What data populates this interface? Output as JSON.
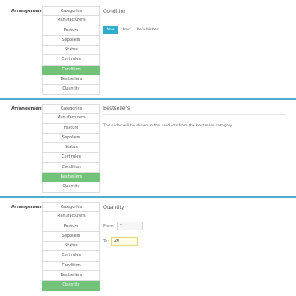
{
  "panels": [
    {
      "arrangement_label": "Arrangement",
      "menu": [
        "Categories",
        "Manufacturers",
        "Feature",
        "Suppliers",
        "Status",
        "Cart rules",
        "Condition",
        "Bestsellers",
        "Quantity"
      ],
      "active_item": "Condition",
      "title": "Condition",
      "condition_buttons": [
        "New",
        "Used",
        "Refurbished"
      ],
      "active_button": "New"
    },
    {
      "arrangement_label": "Arrangement",
      "menu": [
        "Categories",
        "Manufacturers",
        "Feature",
        "Suppliers",
        "Status",
        "Cart rules",
        "Condition",
        "Bestsellers",
        "Quantity"
      ],
      "active_item": "Bestsellers",
      "title": "Bestsellers",
      "description": "The slider will be shown in the products from the bestseller category"
    },
    {
      "arrangement_label": "Arrangement",
      "menu": [
        "Categories",
        "Manufacturers",
        "Feature",
        "Suppliers",
        "Status",
        "Cart rules",
        "Condition",
        "Bestsellers",
        "Quantity"
      ],
      "active_item": "Quantity",
      "title": "Quantity",
      "from_label": "From:",
      "from_value": "5",
      "to_label": "To:",
      "to_value": "20"
    }
  ],
  "colors": {
    "active_menu": "#72c279",
    "active_button": "#2eacce",
    "divider": "#4aaed3"
  }
}
